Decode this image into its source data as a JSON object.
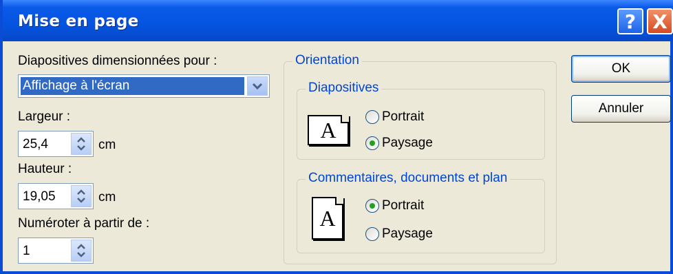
{
  "window": {
    "title": "Mise en page",
    "help_label": "?",
    "close_label": "X"
  },
  "left": {
    "sized_for_label": "Diapositives dimensionnées pour :",
    "sized_for_value": "Affichage à l'écran",
    "width_label": "Largeur :",
    "width_value": "25,4",
    "width_unit": "cm",
    "height_label": "Hauteur :",
    "height_value": "19,05",
    "height_unit": "cm",
    "number_from_label": "Numéroter à partir de :",
    "number_from_value": "1"
  },
  "orientation": {
    "title": "Orientation",
    "slides": {
      "title": "Diapositives",
      "portrait": "Portrait",
      "landscape": "Paysage",
      "selected": "landscape"
    },
    "notes": {
      "title": "Commentaires, documents et plan",
      "portrait": "Portrait",
      "landscape": "Paysage",
      "selected": "portrait"
    },
    "icon_letter": "A"
  },
  "buttons": {
    "ok": "OK",
    "cancel": "Annuler"
  }
}
